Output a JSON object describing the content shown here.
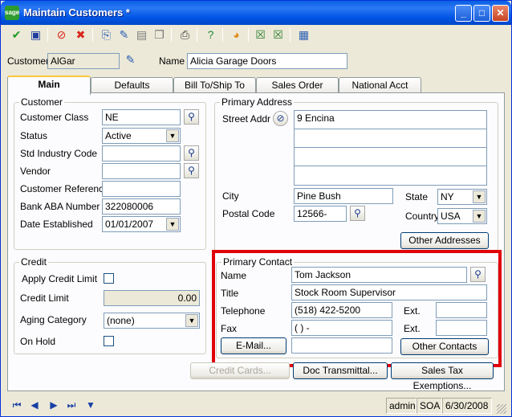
{
  "window": {
    "title": "Maintain Customers *",
    "logo_text": "sage",
    "controls": {
      "minimize": "_",
      "maximize": "□",
      "close": "✕"
    }
  },
  "toolbar": {
    "icons": [
      "accept-icon",
      "save-icon",
      "cancel-icon",
      "delete-icon",
      "copy-icon",
      "rename-icon",
      "notes-icon",
      "memo-icon",
      "print-icon",
      "help-icon",
      "color-icon",
      "customize-icon",
      "export-icon",
      "settings-icon"
    ]
  },
  "header": {
    "customer_label": "Customer",
    "customer_value": "AlGar",
    "name_label": "Name",
    "name_value": "Alicia Garage Doors"
  },
  "tabs": [
    {
      "label": "Main",
      "active": true
    },
    {
      "label": "Defaults"
    },
    {
      "label": "Bill To/Ship To"
    },
    {
      "label": "Sales Order"
    },
    {
      "label": "National Acct"
    }
  ],
  "customer_group": {
    "title": "Customer",
    "class_label": "Customer Class",
    "class_value": "NE",
    "status_label": "Status",
    "status_value": "Active",
    "sic_label": "Std Industry Code",
    "sic_value": "",
    "vendor_label": "Vendor",
    "vendor_value": "",
    "ref_label": "Customer Reference",
    "ref_value": "",
    "aba_label": "Bank ABA Number",
    "aba_value": "322080006",
    "date_label": "Date Established",
    "date_value": "01/01/2007"
  },
  "credit_group": {
    "title": "Credit",
    "apply_label": "Apply Credit Limit",
    "limit_label": "Credit Limit",
    "limit_value": "0.00",
    "aging_label": "Aging Category",
    "aging_value": "(none)",
    "hold_label": "On Hold"
  },
  "address_group": {
    "title": "Primary Address",
    "street_label": "Street Addr",
    "street_lines": [
      "9 Encina",
      "",
      "",
      ""
    ],
    "city_label": "City",
    "city_value": "Pine Bush",
    "state_label": "State",
    "state_value": "NY",
    "postal_label": "Postal Code",
    "postal_value": "12566-",
    "country_label": "Country",
    "country_value": "USA",
    "other_addresses_btn": "Other Addresses"
  },
  "contact_group": {
    "title": "Primary Contact",
    "name_label": "Name",
    "name_value": "Tom Jackson",
    "title_label": "Title",
    "title_value": "Stock Room Supervisor",
    "phone_label": "Telephone",
    "phone_value": "(518) 422-5200",
    "ext_label": "Ext.",
    "phone_ext": "",
    "fax_label": "Fax",
    "fax_value": "(   )    -",
    "fax_ext": "",
    "email_btn": "E-Mail...",
    "email_value": "",
    "other_contacts_btn": "Other Contacts"
  },
  "bottom_buttons": {
    "credit_cards": "Credit Cards...",
    "doc_transmittal": "Doc Transmittal...",
    "sales_tax": "Sales Tax Exemptions..."
  },
  "status": {
    "user": "admin",
    "company": "SOA",
    "date": "6/30/2008"
  },
  "colors": {
    "title_bar": "#0055E5",
    "highlight": "#E0000A"
  }
}
